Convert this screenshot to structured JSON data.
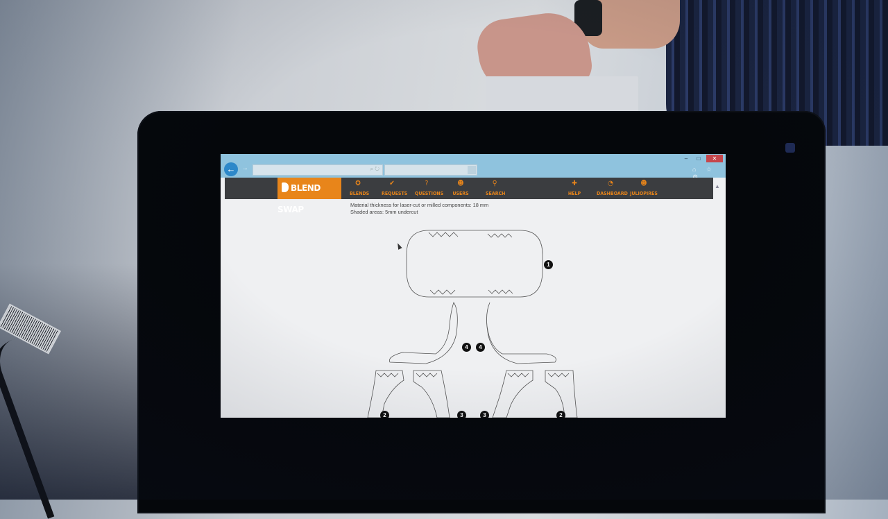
{
  "browser": {
    "window_controls": {
      "minimize": "–",
      "maximize": "□",
      "close": "✕"
    },
    "back_icon": "arrow-left-icon",
    "forward_icon": "arrow-right-icon",
    "address_value": "",
    "address_icons": "⌕ ↻",
    "toolbar_icons": "⌂ ☆ ⚙"
  },
  "site": {
    "logo_text": "BLEND SWAP",
    "brand_color": "#e8851a",
    "nav_items": [
      {
        "label": "BLENDS",
        "icon": "blends-icon",
        "glyph": "✪"
      },
      {
        "label": "REQUESTS",
        "icon": "requests-icon",
        "glyph": "✔"
      },
      {
        "label": "QUESTIONS",
        "icon": "questions-icon",
        "glyph": "?"
      },
      {
        "label": "USERS",
        "icon": "users-icon",
        "glyph": "☻"
      },
      {
        "label": "SEARCH",
        "icon": "search-icon",
        "glyph": "⚲"
      }
    ],
    "right_nav": [
      {
        "label": "HELP",
        "icon": "help-icon",
        "glyph": "✚"
      },
      {
        "label": "DASHBOARD",
        "icon": "dashboard-icon",
        "glyph": "◔"
      },
      {
        "label": "JULIOPIRES",
        "icon": "user-icon",
        "glyph": "☻"
      }
    ]
  },
  "content": {
    "line1": "Material thickness for laser-cut or milled components: 18 mm",
    "line2": "Shaded areas: 5mm undercut",
    "part_numbers": [
      "1",
      "4",
      "4",
      "2",
      "3",
      "3",
      "2"
    ]
  }
}
